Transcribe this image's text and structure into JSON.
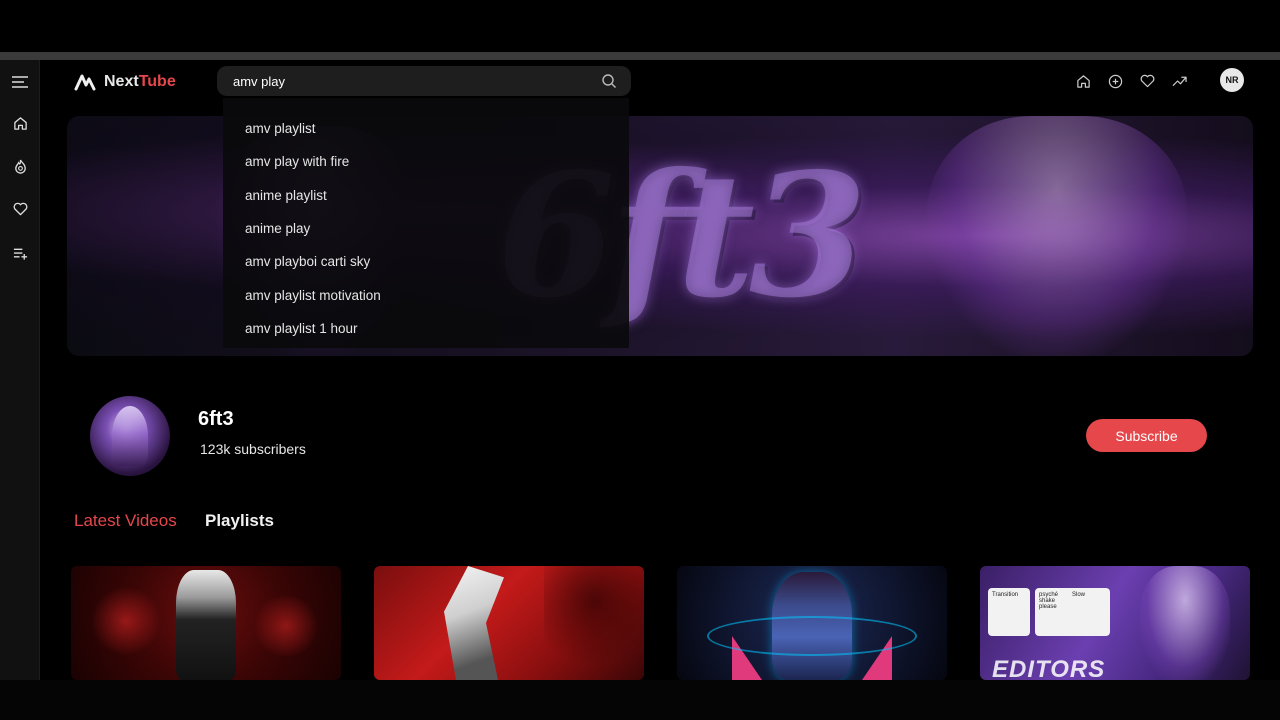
{
  "app": {
    "brand_first": "Next",
    "brand_second": "Tube"
  },
  "colors": {
    "accent": "#e5474b",
    "background": "#000000",
    "sidebar": "#111111"
  },
  "sidebar": {
    "items": [
      {
        "icon": "menu-icon"
      },
      {
        "icon": "home-icon"
      },
      {
        "icon": "trending-icon"
      },
      {
        "icon": "heart-icon"
      },
      {
        "icon": "playlist-add-icon"
      }
    ]
  },
  "search": {
    "value": "amv play",
    "placeholder": "",
    "suggestions": [
      "amv playlist",
      "amv play with fire",
      "anime playlist",
      "anime play",
      "amv playboi carti sky",
      "amv playlist motivation",
      "amv playlist 1 hour"
    ]
  },
  "header": {
    "icons": [
      "home-icon",
      "add-circle-icon",
      "heart-icon",
      "trending-up-icon"
    ],
    "avatar_initials": "NR"
  },
  "banner": {
    "title": "6ft3"
  },
  "channel": {
    "name": "6ft3",
    "subscribers": "123k subscribers",
    "subscribe_label": "Subscribe"
  },
  "tabs": [
    {
      "label": "Latest Videos",
      "active": true
    },
    {
      "label": "Playlists",
      "active": false
    }
  ],
  "videos": [
    {
      "overlay_text": ""
    },
    {
      "overlay_text": ""
    },
    {
      "overlay_text": ""
    },
    {
      "overlay_text": "EDITORS",
      "cards": [
        "Transition",
        "psyché shake please",
        "Slow"
      ]
    }
  ]
}
